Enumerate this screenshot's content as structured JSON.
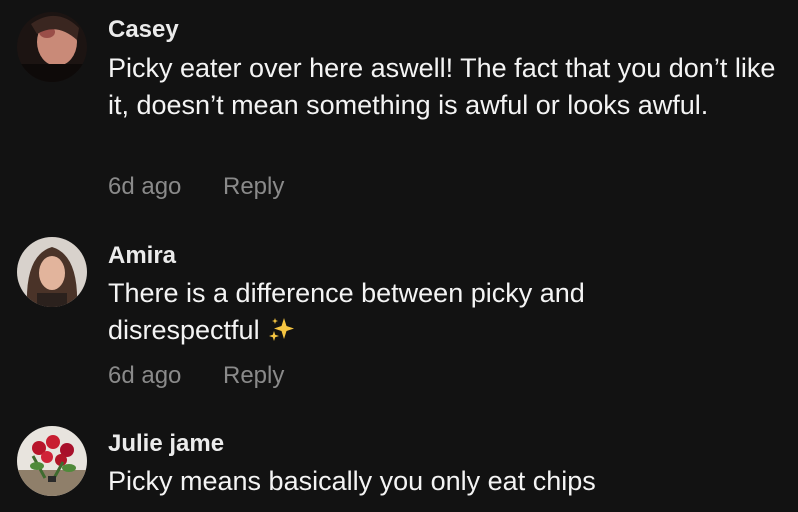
{
  "comments": [
    {
      "username": "Casey",
      "text": "Picky eater over here aswell! The fact that you don’t like it, doesn’t mean something is awful or looks awful.",
      "time": "6d ago",
      "reply_label": "Reply",
      "avatar_icon": "avatar-photo-casey"
    },
    {
      "username": "Amira",
      "text": "There is a difference between picky and disrespectful",
      "emoji": "sparkles-icon",
      "time": "6d ago",
      "reply_label": "Reply",
      "avatar_icon": "avatar-photo-amira"
    },
    {
      "username": "Julie jame",
      "text": "Picky means basically you only eat chips",
      "avatar_icon": "avatar-photo-julie"
    }
  ],
  "colors": {
    "background": "#121212",
    "username": "#ebebeb",
    "text": "#f4f4f4",
    "meta": "#8a8a8a",
    "sparkle": "#f5c542"
  }
}
